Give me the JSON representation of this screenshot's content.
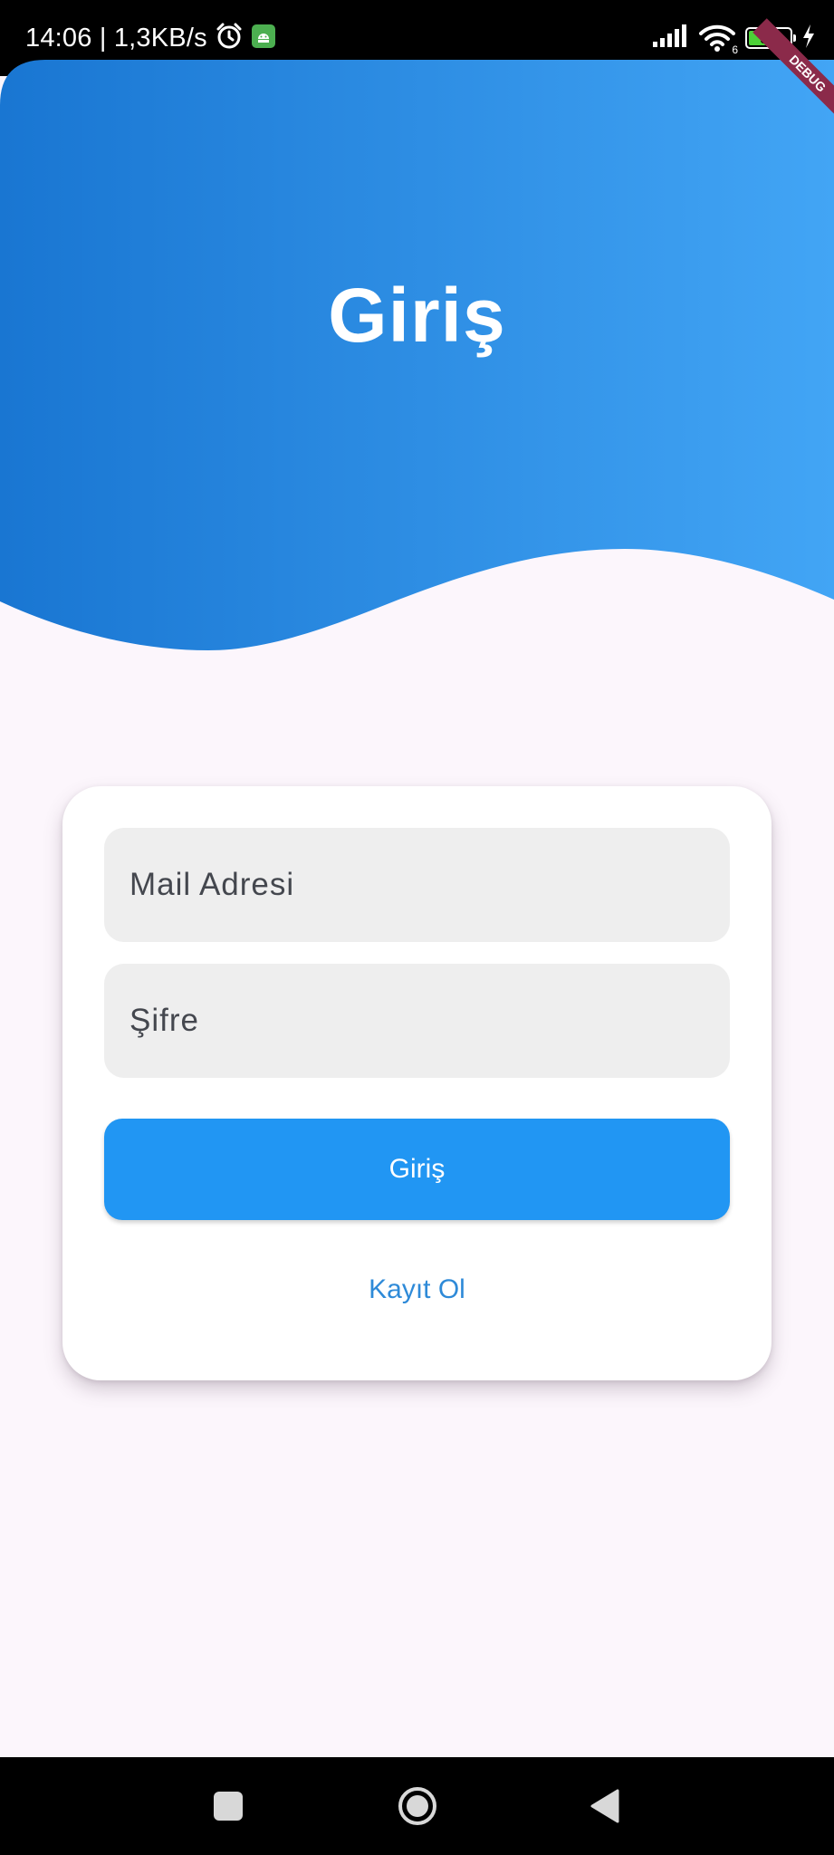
{
  "status_bar": {
    "time_speed": "14:06 | 1,3KB/s",
    "battery": "58",
    "wifi_badge": "6",
    "battery_level": 0.58,
    "icons": [
      "alarm-clock-icon",
      "android-app-icon",
      "signal-icon",
      "wifi-icon",
      "battery-icon",
      "charging-bolt-icon"
    ]
  },
  "header": {
    "title": "Giriş",
    "debug_banner": "DEBUG",
    "gradient_start": "#1976d2",
    "gradient_end": "#42a5f5"
  },
  "form": {
    "email_placeholder": "Mail Adresi",
    "password_placeholder": "Şifre",
    "login_label": "Giriş",
    "register_label": "Kayıt Ol",
    "button_color": "#2196f3",
    "link_color": "#2e8ad8"
  },
  "nav_bar": {
    "icons": [
      "recents-square-icon",
      "home-circle-icon",
      "back-triangle-icon"
    ]
  },
  "colors": {
    "background": "#fcf6fc",
    "card": "#ffffff",
    "input_fill": "#eeeeee"
  }
}
